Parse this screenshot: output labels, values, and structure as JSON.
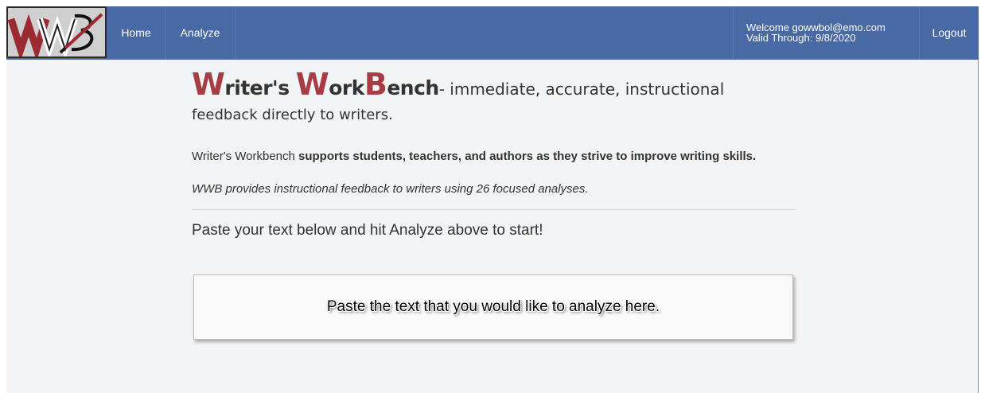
{
  "nav": {
    "logo_text": "WWB",
    "home_label": "Home",
    "analyze_label": "Analyze",
    "welcome_text": "Welcome gowwbol@emo.com",
    "valid_text": "Valid Through: 9/8/2020",
    "logout_label": "Logout"
  },
  "brand": {
    "w1_cap": "W",
    "w1_rest": "riter's ",
    "w2_cap": "W",
    "w2_rest": "ork",
    "b_cap": "B",
    "b_rest": "ench",
    "tagline": "- immediate, accurate, instructional",
    "tagline2": "feedback directly to writers."
  },
  "intro": {
    "supports_lead": "Writer's Workbench",
    "supports_bold": " supports students, teachers, and authors as they strive to improve writing skills.",
    "provides": "WWB provides instructional feedback to writers using 26 focused analyses."
  },
  "paste": {
    "heading": "Paste your text below and hit Analyze above to start!",
    "placeholder": "Paste the text that you would like to analyze here."
  },
  "colors": {
    "navbar": "#4869a3",
    "brand_accent": "#a83c45",
    "background": "#f3f4f5"
  }
}
